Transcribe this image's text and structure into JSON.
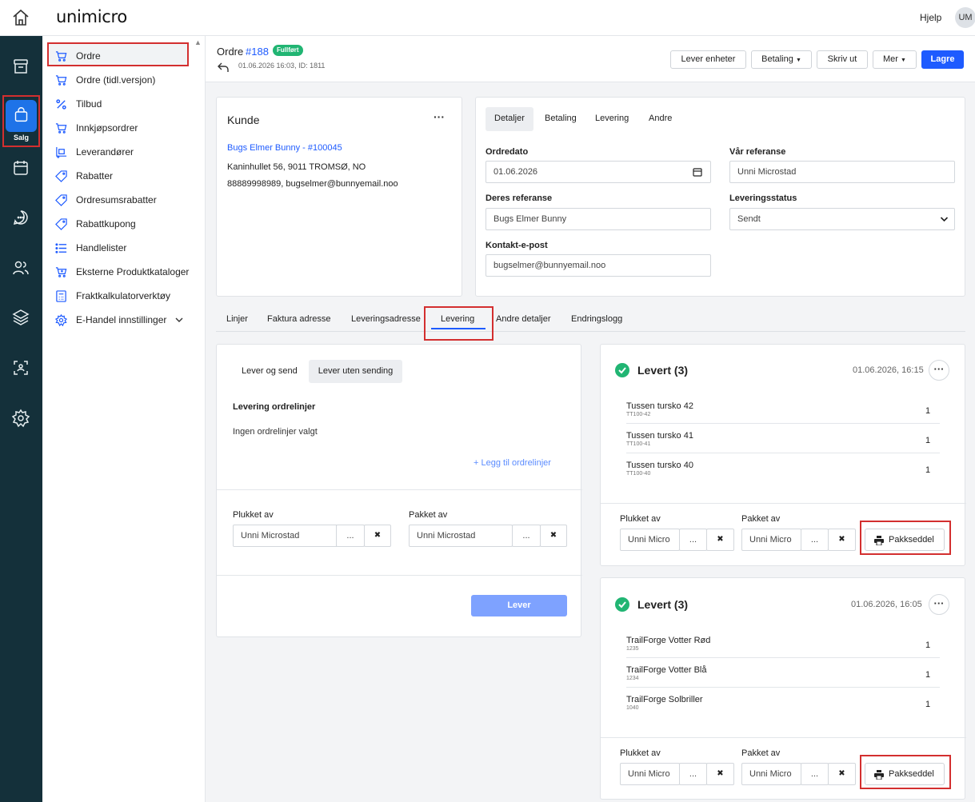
{
  "app": {
    "logo": "unimicro",
    "help": "Hjelp",
    "avatar": "UM"
  },
  "rail": {
    "salg_label": "Salg"
  },
  "sidenav": {
    "items": [
      {
        "label": "Ordre"
      },
      {
        "label": "Ordre (tidl.versjon)"
      },
      {
        "label": "Tilbud"
      },
      {
        "label": "Innkjøpsordrer"
      },
      {
        "label": "Leverandører"
      },
      {
        "label": "Rabatter"
      },
      {
        "label": "Ordresumsrabatter"
      },
      {
        "label": "Rabattkupong"
      },
      {
        "label": "Handlelister"
      },
      {
        "label": "Eksterne Produktkataloger"
      },
      {
        "label": "Fraktkalkulatorverktøy"
      },
      {
        "label": "E-Handel innstillinger"
      }
    ]
  },
  "header": {
    "title": "Ordre",
    "order_no": "#188",
    "status": "Fullført",
    "meta": "01.06.2026 16:03, ID: 1811",
    "buttons": {
      "lever_enheter": "Lever enheter",
      "betaling": "Betaling",
      "skriv_ut": "Skriv ut",
      "mer": "Mer",
      "lagre": "Lagre"
    }
  },
  "kunde": {
    "title": "Kunde",
    "name": "Bugs Elmer Bunny - #100045",
    "address": "Kaninhullet 56, 9011 TROMSØ, NO",
    "contact": "88889998989, bugselmer@bunnyemail.noo"
  },
  "details": {
    "tabs": [
      "Detaljer",
      "Betaling",
      "Levering",
      "Andre"
    ],
    "ordredato_label": "Ordredato",
    "ordredato": "01.06.2026",
    "var_ref_label": "Vår referanse",
    "var_ref": "Unni Microstad",
    "deres_ref_label": "Deres referanse",
    "deres_ref": "Bugs Elmer Bunny",
    "leveringsstatus_label": "Leveringsstatus",
    "leveringsstatus": "Sendt",
    "kontakt_label": "Kontakt-e-post",
    "kontakt": "bugselmer@bunnyemail.noo"
  },
  "main_tabs": [
    "Linjer",
    "Faktura adresse",
    "Leveringsadresse",
    "Levering",
    "Andre detaljer",
    "Endringslogg"
  ],
  "levering": {
    "toggle": [
      "Lever og send",
      "Lever uten sending"
    ],
    "section_title": "Levering ordrelinjer",
    "empty": "Ingen ordrelinjer valgt",
    "add_link": "+ Legg til ordrelinjer",
    "plukket_label": "Plukket av",
    "plukket": "Unni Microstad",
    "pakket_label": "Pakket av",
    "pakket": "Unni Microstad",
    "dots": "...",
    "clear": "✖",
    "lever_btn": "Lever"
  },
  "deliveries": [
    {
      "title": "Levert (3)",
      "date": "01.06.2026, 16:15",
      "items": [
        {
          "name": "Tussen tursko 42",
          "sku": "TT100-42",
          "qty": "1"
        },
        {
          "name": "Tussen tursko 41",
          "sku": "TT100-41",
          "qty": "1"
        },
        {
          "name": "Tussen tursko 40",
          "sku": "TT100-40",
          "qty": "1"
        }
      ],
      "plukket_label": "Plukket av",
      "plukket": "Unni Micro",
      "pakket_label": "Pakket av",
      "pakket": "Unni Micro",
      "pakkseddel": "Pakkseddel"
    },
    {
      "title": "Levert (3)",
      "date": "01.06.2026, 16:05",
      "items": [
        {
          "name": "TrailForge Votter Rød",
          "sku": "1235",
          "qty": "1"
        },
        {
          "name": "TrailForge Votter Blå",
          "sku": "1234",
          "qty": "1"
        },
        {
          "name": "TrailForge Solbriller",
          "sku": "1040",
          "qty": "1"
        }
      ],
      "plukket_label": "Plukket av",
      "plukket": "Unni Micro",
      "pakket_label": "Pakket av",
      "pakket": "Unni Micro",
      "pakkseddel": "Pakkseddel"
    }
  ],
  "colors": {
    "accent": "#1e5bff",
    "rail": "#14303a",
    "success": "#21b573",
    "highlight": "#d32f2f"
  }
}
